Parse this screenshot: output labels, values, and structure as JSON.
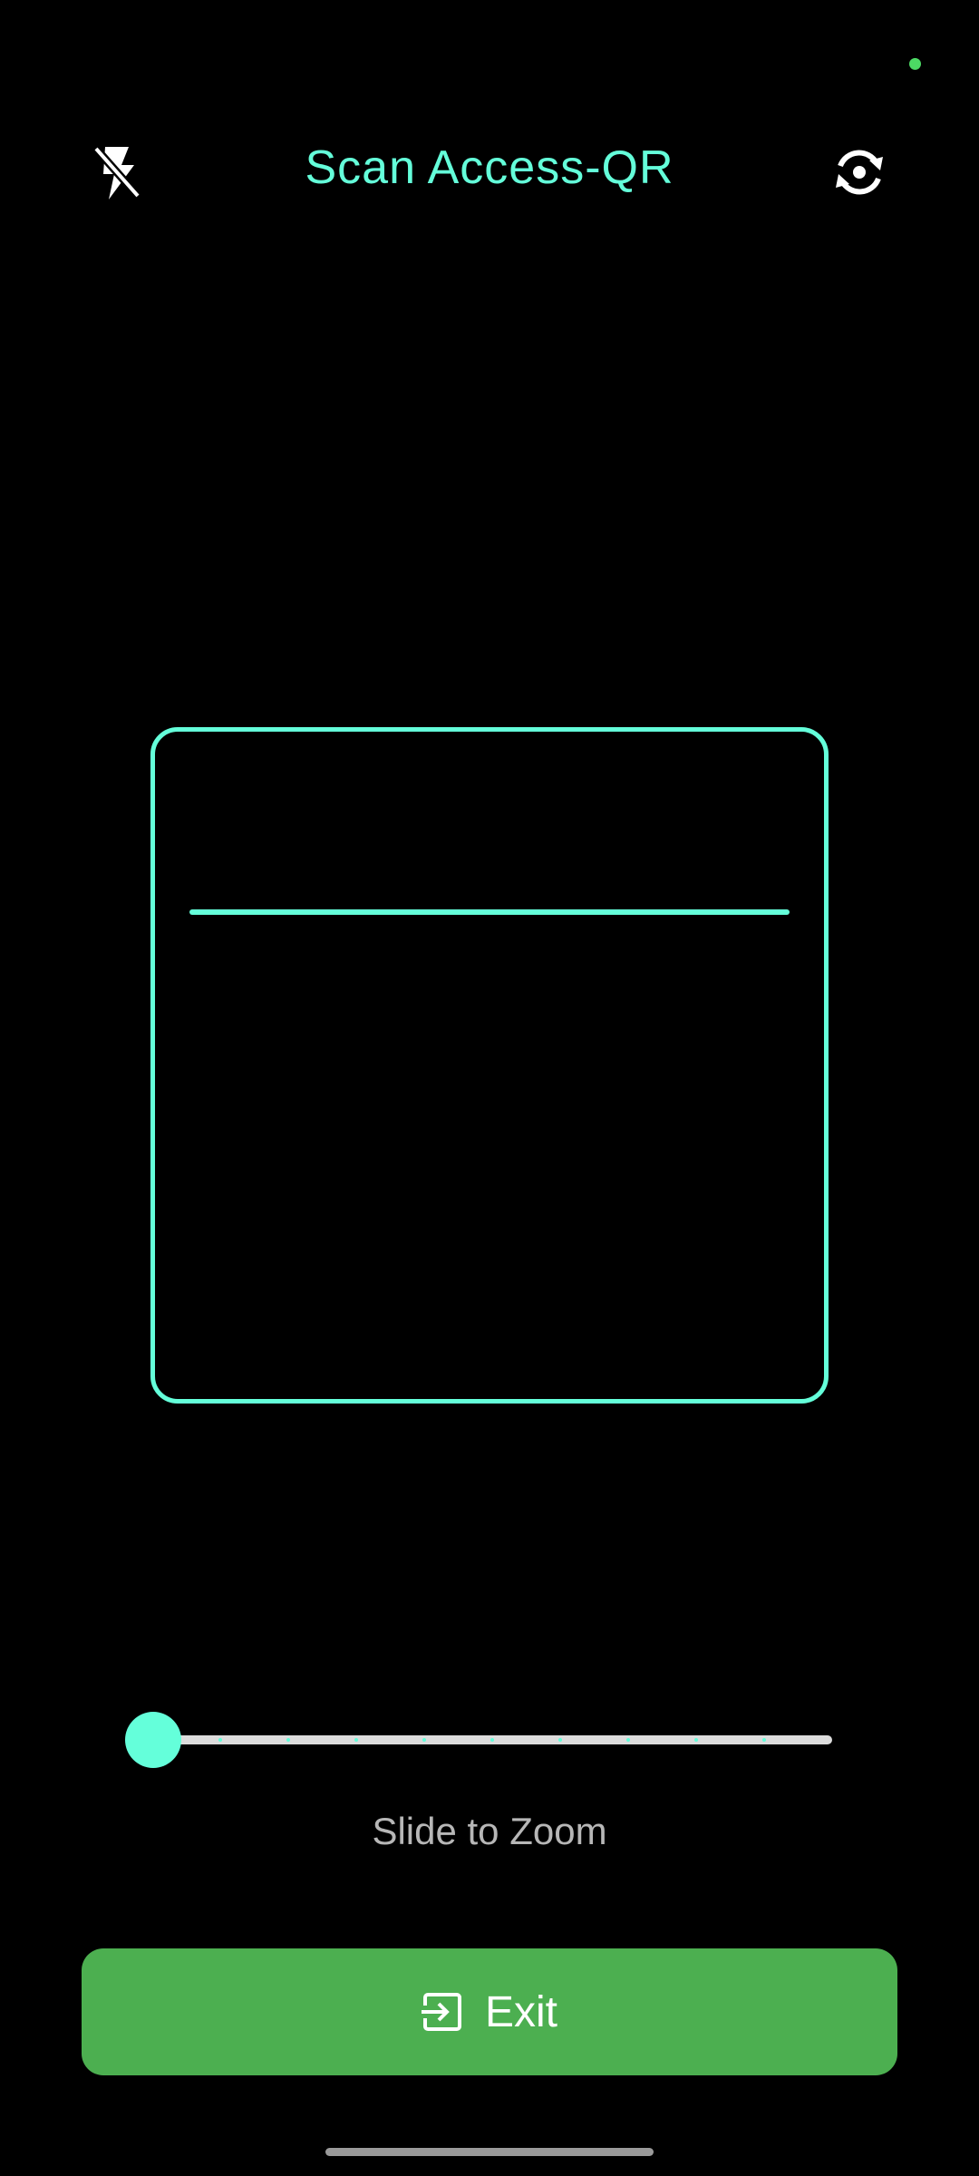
{
  "colors": {
    "accent": "#64FFDA",
    "button": "#4CAF50",
    "status_dot": "#4CD964",
    "icon": "#FFFFFF"
  },
  "header": {
    "title": "Scan Access-QR",
    "flash_icon": "flash-off-icon",
    "camera_icon": "switch-camera-icon"
  },
  "zoom": {
    "caption": "Slide to Zoom",
    "value": 0,
    "steps": 10
  },
  "exit": {
    "label": "Exit",
    "icon": "exit-icon"
  }
}
